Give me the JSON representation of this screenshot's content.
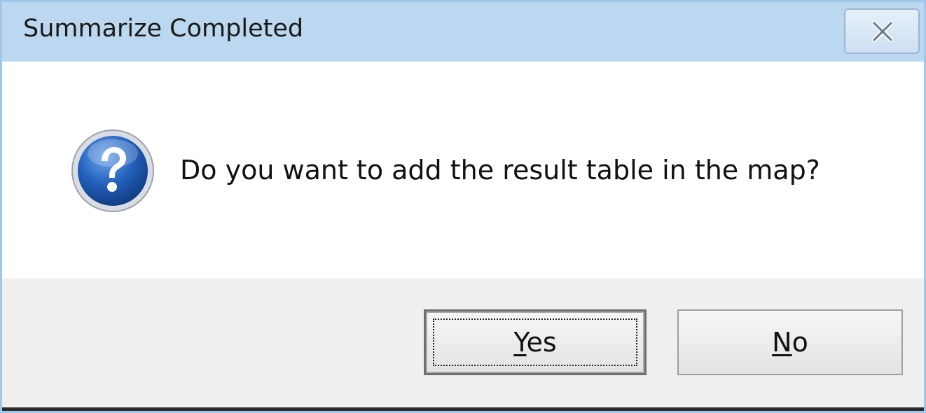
{
  "window": {
    "title": "Summarize Completed"
  },
  "dialog": {
    "icon": "question-icon",
    "message": "Do you want to add the result table in the map?"
  },
  "buttons": {
    "yes": {
      "accel": "Y",
      "rest": "es"
    },
    "no": {
      "accel": "N",
      "rest": "o"
    }
  },
  "colors": {
    "title_bar": "#bcd7f0",
    "footer": "#efefef",
    "icon_blue": "#1f5fb4"
  }
}
